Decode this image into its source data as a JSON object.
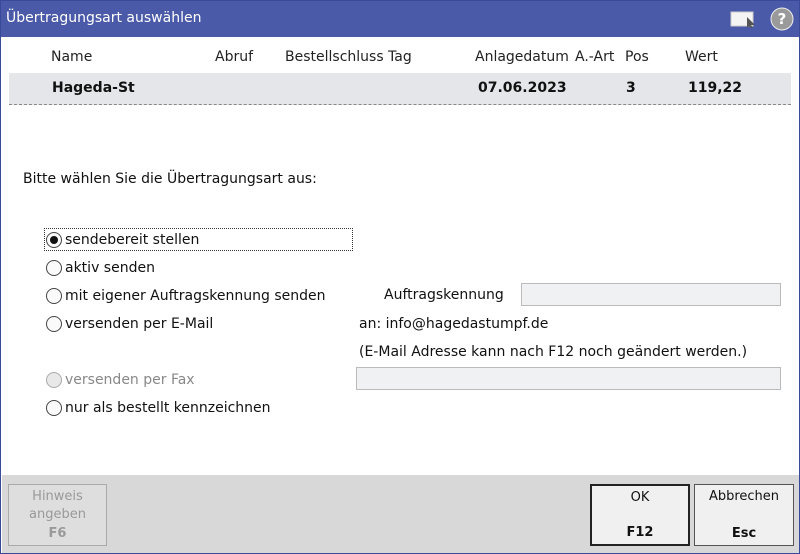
{
  "window": {
    "title": "Übertragungsart auswählen"
  },
  "table": {
    "headers": [
      "Name",
      "Abruf",
      "Bestellschluss Tag",
      "Anlagedatum",
      "A.-Art",
      "Pos",
      "Wert"
    ],
    "row": {
      "name": "Hageda-St",
      "anlagedatum": "07.06.2023",
      "pos": "3",
      "wert": "119,22"
    }
  },
  "prompt": "Bitte wählen Sie die Übertragungsart aus:",
  "options": [
    {
      "label": "sendebereit stellen",
      "checked": true,
      "enabled": true
    },
    {
      "label": "aktiv senden",
      "checked": false,
      "enabled": true
    },
    {
      "label": "mit eigener Auftragskennung senden",
      "checked": false,
      "enabled": true
    },
    {
      "label": "versenden per E-Mail",
      "checked": false,
      "enabled": true
    },
    {
      "label": "versenden per Fax",
      "checked": false,
      "enabled": false
    },
    {
      "label": "nur als bestellt kennzeichnen",
      "checked": false,
      "enabled": true
    }
  ],
  "auftragskennung": {
    "label": "Auftragskennung",
    "value": ""
  },
  "email": {
    "to": "an: info@hagedastumpf.de",
    "note": "(E-Mail Adresse kann nach F12 noch geändert werden.)"
  },
  "fax": {
    "value": ""
  },
  "buttons": {
    "hinweis": {
      "line1": "Hinweis",
      "line1b": "angeben",
      "key": "F6"
    },
    "ok": {
      "label": "OK",
      "key": "F12"
    },
    "abbrechen": {
      "label": "Abbrechen",
      "key": "Esc"
    }
  },
  "colors": {
    "titlebar": "#4a5aa8",
    "footer": "#d8d8d8",
    "rowband": "#e4e6ea"
  },
  "icons": {
    "window_button": "window-icon",
    "help": "help-icon"
  }
}
